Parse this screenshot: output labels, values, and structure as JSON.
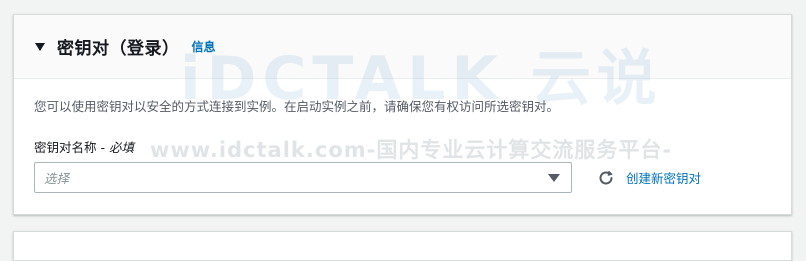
{
  "section": {
    "title": "密钥对（登录）",
    "info_link": "信息",
    "description": "您可以使用密钥对以安全的方式连接到实例。在启动实例之前，请确保您有权访问所选密钥对。"
  },
  "key_pair_field": {
    "label": "密钥对名称",
    "separator": " - ",
    "required": "必填",
    "placeholder": "选择",
    "refresh_icon": "refresh-icon",
    "create_link": "创建新密钥对"
  },
  "watermark": {
    "logo": "iDCTALK 云说",
    "text": "www.idctalk.com-国内专业云计算交流服务平台-"
  },
  "colors": {
    "link": "#0073bb",
    "border": "#aab7b8",
    "background": "#f2f3f3"
  }
}
